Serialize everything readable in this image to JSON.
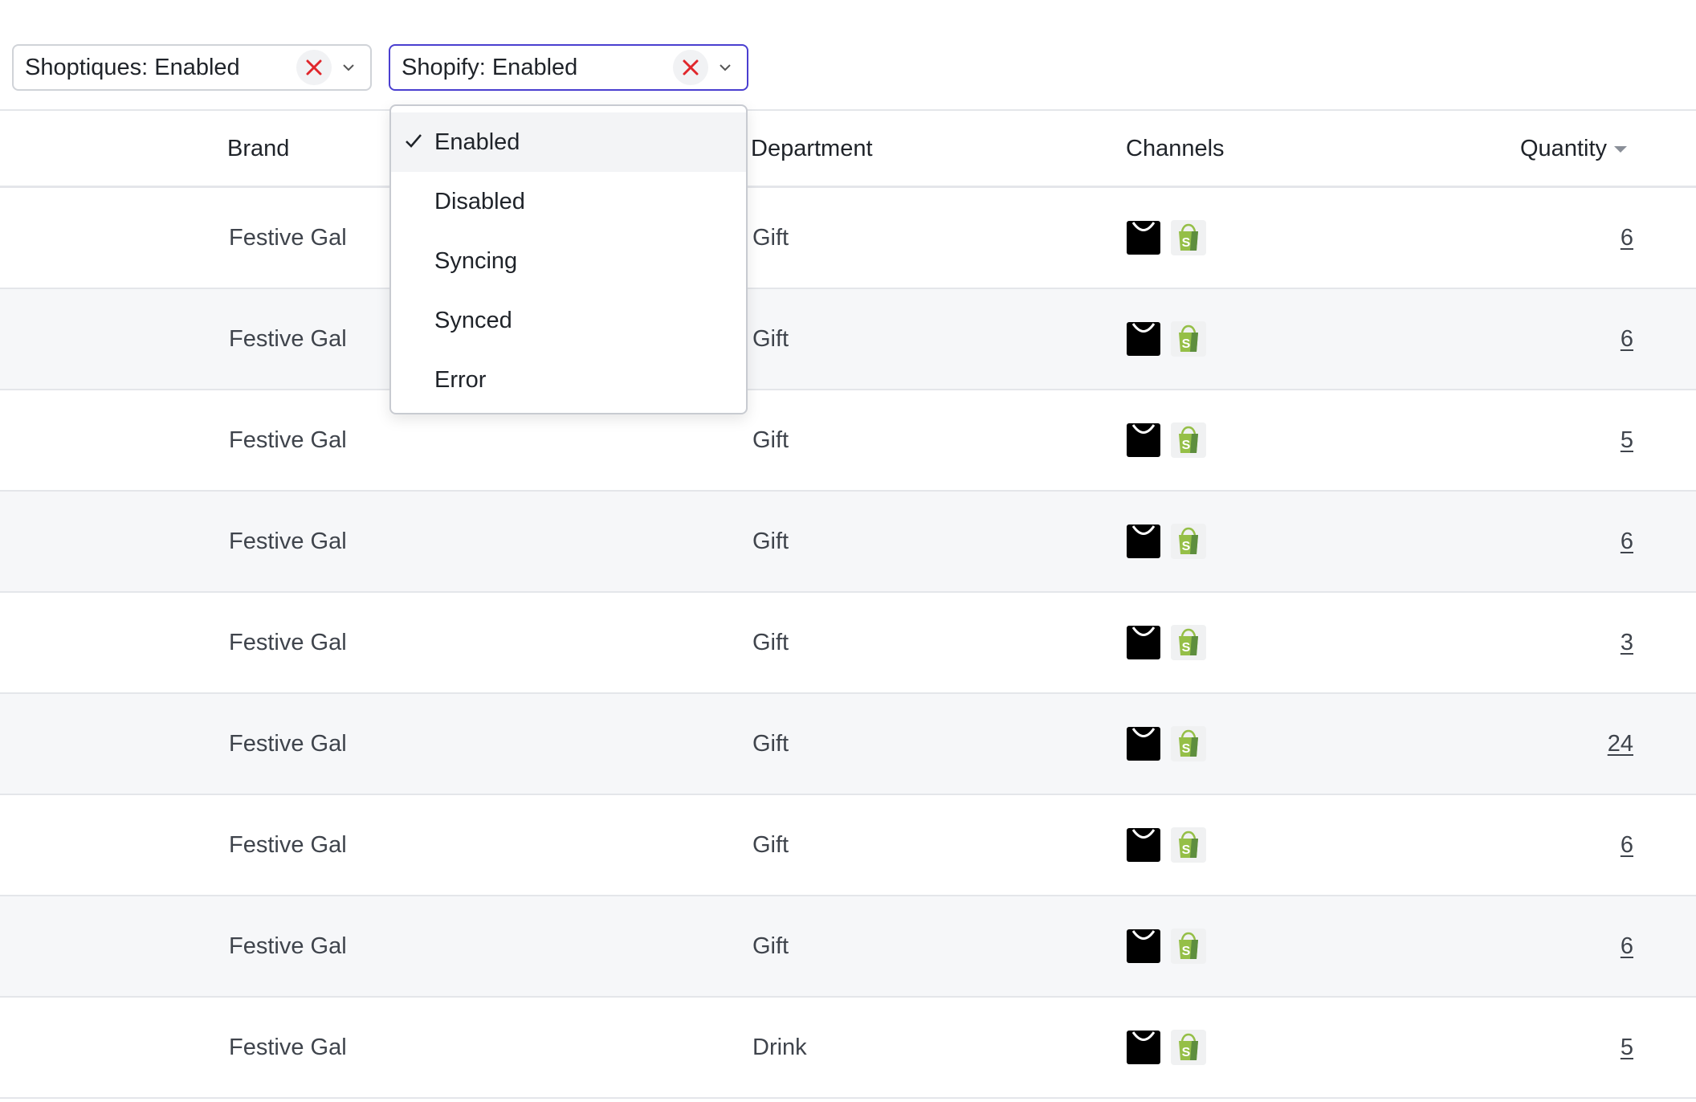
{
  "filters": [
    {
      "label": "Shoptiques: Enabled"
    },
    {
      "label": "Shopify: Enabled"
    }
  ],
  "columns": {
    "brand": "Brand",
    "department": "Department",
    "channels": "Channels",
    "quantity": "Quantity"
  },
  "rows": [
    {
      "brand": "Festive Gal",
      "department": "Gift",
      "quantity": "6"
    },
    {
      "brand": "Festive Gal",
      "department": "Gift",
      "quantity": "6"
    },
    {
      "brand": "Festive Gal",
      "department": "Gift",
      "quantity": "5"
    },
    {
      "brand": "Festive Gal",
      "department": "Gift",
      "quantity": "6"
    },
    {
      "brand": "Festive Gal",
      "department": "Gift",
      "quantity": "3"
    },
    {
      "brand": "Festive Gal",
      "department": "Gift",
      "quantity": "24"
    },
    {
      "brand": "Festive Gal",
      "department": "Gift",
      "quantity": "6"
    },
    {
      "brand": "Festive Gal",
      "department": "Gift",
      "quantity": "6"
    },
    {
      "brand": "Festive Gal",
      "department": "Drink",
      "quantity": "5"
    }
  ],
  "channel_icons": [
    "shoptiques-bag-icon",
    "shopify-bag-icon"
  ],
  "dropdown": {
    "options": [
      "Enabled",
      "Disabled",
      "Syncing",
      "Synced",
      "Error"
    ],
    "selected": "Enabled"
  },
  "colors": {
    "active_border": "#4a3fd0",
    "clear_icon": "#e0262b",
    "shopify_green": "#95bf47",
    "row_alt": "#f6f7f9"
  }
}
